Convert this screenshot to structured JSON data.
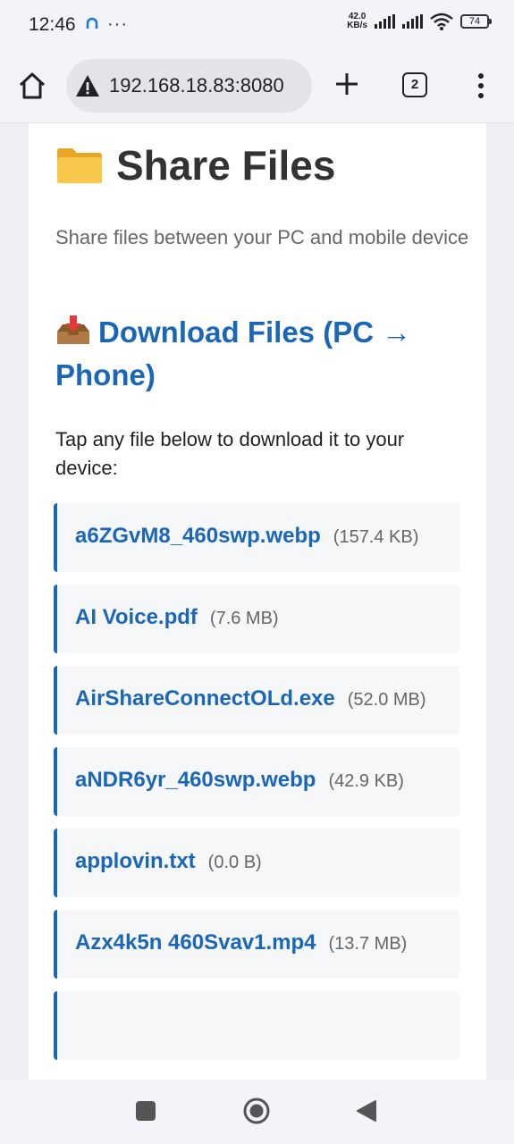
{
  "status_bar": {
    "time": "12:46",
    "net_speed_value": "42.0",
    "net_speed_unit": "KB/s",
    "battery": "74",
    "more_indicator": "···"
  },
  "toolbar": {
    "url": "192.168.18.83:8080",
    "tab_count": "2"
  },
  "page": {
    "title": "Share Files",
    "subtitle": "Share files between your PC and mobile device",
    "section_heading": "Download Files (PC → Phone)",
    "instructions": "Tap any file below to download it to your device:"
  },
  "files": [
    {
      "name": "a6ZGvM8_460swp.webp",
      "size": "(157.4 KB)"
    },
    {
      "name": "AI Voice.pdf",
      "size": "(7.6 MB)"
    },
    {
      "name": "AirShareConnectOLd.exe",
      "size": "(52.0 MB)"
    },
    {
      "name": "aNDR6yr_460swp.webp",
      "size": "(42.9 KB)"
    },
    {
      "name": "applovin.txt",
      "size": "(0.0 B)"
    },
    {
      "name": "Azx4k5n 460Svav1.mp4",
      "size": "(13.7 MB)"
    },
    {
      "name": "",
      "size": ""
    }
  ],
  "colors": {
    "accent": "#1a66b8",
    "title": "#333333",
    "muted": "#666666"
  }
}
